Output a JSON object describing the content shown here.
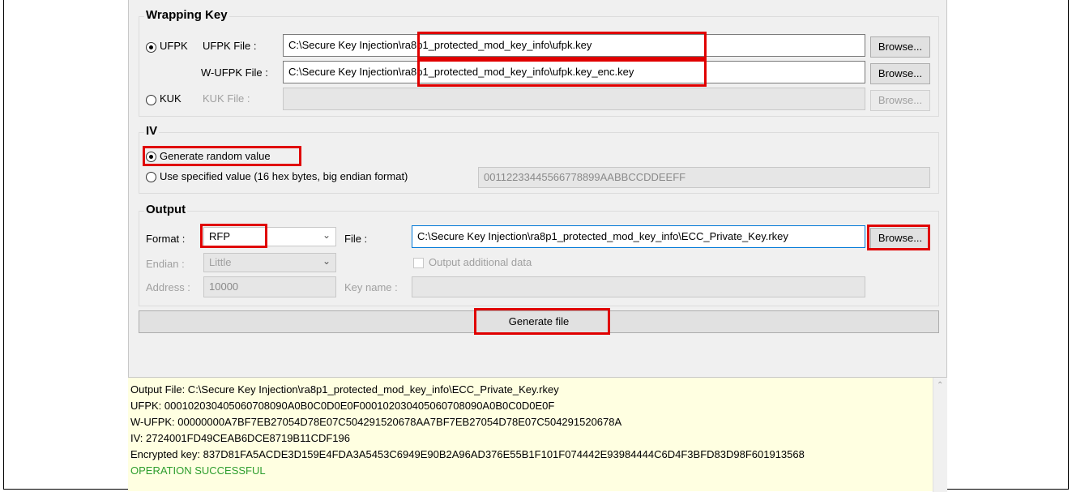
{
  "wrapping_key": {
    "title": "Wrapping Key",
    "ufpk_radio": "UFPK",
    "ufpk_file_label": "UFPK File :",
    "ufpk_file_value": "C:\\Secure Key Injection\\ra8p1_protected_mod_key_info\\ufpk.key",
    "wufpk_file_label": "W-UFPK File :",
    "wufpk_file_value": "C:\\Secure Key Injection\\ra8p1_protected_mod_key_info\\ufpk.key_enc.key",
    "kuk_radio": "KUK",
    "kuk_file_label": "KUK File :",
    "kuk_file_value": "",
    "browse": "Browse..."
  },
  "iv": {
    "title": "IV",
    "generate_random": "Generate random value",
    "use_specified": "Use specified value (16 hex bytes, big endian format)",
    "specified_value": "00112233445566778899AABBCCDDEEFF"
  },
  "output": {
    "title": "Output",
    "format_label": "Format :",
    "format_value": "RFP",
    "file_label": "File :",
    "file_value": "C:\\Secure Key Injection\\ra8p1_protected_mod_key_info\\ECC_Private_Key.rkey",
    "browse": "Browse...",
    "endian_label": "Endian :",
    "endian_value": "Little",
    "additional_data": "Output additional data",
    "address_label": "Address :",
    "address_value": "10000",
    "key_name_label": "Key name :",
    "key_name_value": ""
  },
  "generate_button": "Generate file",
  "log": {
    "lines": [
      "Output File: C:\\Secure Key Injection\\ra8p1_protected_mod_key_info\\ECC_Private_Key.rkey",
      "UFPK: 000102030405060708090A0B0C0D0E0F000102030405060708090A0B0C0D0E0F",
      "W-UFPK: 00000000A7BF7EB27054D78E07C504291520678AA7BF7EB27054D78E07C504291520678A",
      "IV: 2724001FD49CEAB6DCE8719B11CDF196",
      "Encrypted key: 837D81FA5ACDE3D159E4FDA3A5453C6949E90B2A96AD376E55B1F101F074442E93984444C6D4F3BFD83D98F601913568"
    ],
    "status": "OPERATION SUCCESSFUL",
    "status_color": "#2e9e2e"
  },
  "colors": {
    "highlight": "#e00000",
    "log_background": "#ffffe1"
  }
}
